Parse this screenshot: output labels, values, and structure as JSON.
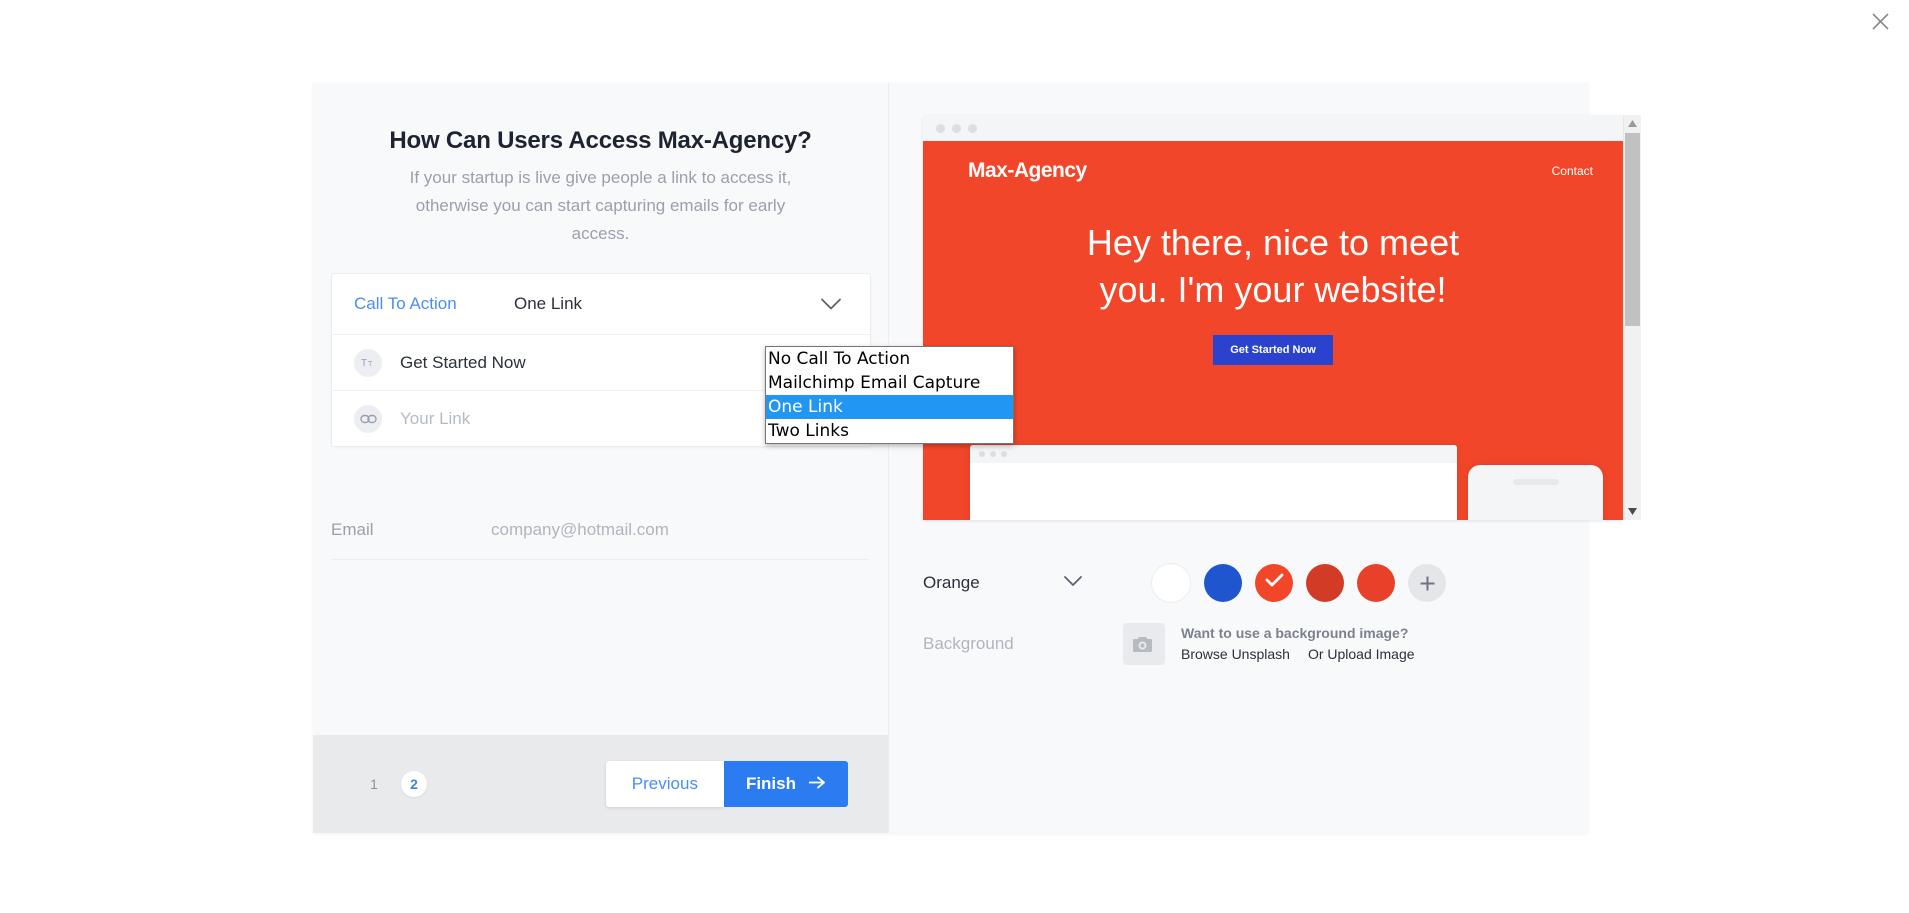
{
  "window": {
    "close_icon": "close-icon"
  },
  "left": {
    "headline": "How Can Users Access Max-Agency?",
    "subhead": "If your startup is live give people a link to access it, otherwise you can start capturing emails for early access.",
    "cta": {
      "label": "Call To Action",
      "selected_value": "One Link",
      "caret_icon": "chevron-down-icon",
      "options": [
        "No Call To Action",
        "Mailchimp Email Capture",
        "One Link",
        "Two Links"
      ],
      "selected_index": 2
    },
    "fields": [
      {
        "icon": "text-format-icon",
        "icon_glyph": "Tт",
        "value": "Get Started Now",
        "is_placeholder": false
      },
      {
        "icon": "link-icon",
        "icon_glyph": "link",
        "value": "Your Link",
        "is_placeholder": true
      }
    ],
    "email": {
      "label": "Email",
      "value": "company@hotmail.com"
    },
    "footer": {
      "steps": [
        "1",
        "2"
      ],
      "active_step": "2",
      "previous_label": "Previous",
      "finish_label": "Finish",
      "finish_arrow_icon": "arrow-right-icon"
    }
  },
  "right": {
    "preview": {
      "logo": "Max-Agency",
      "nav_link": "Contact",
      "hero_line1": "Hey there, nice to meet",
      "hero_line2": "you. I'm your website!",
      "hero_button": "Get Started Now",
      "hero_button_color": "#2b42cf",
      "background_color": "#f2462a"
    },
    "scrollbar": {
      "up_icon": "caret-up-icon",
      "down_icon": "caret-down-icon"
    },
    "color_picker": {
      "name": "Orange",
      "caret_icon": "chevron-down-icon",
      "add_icon": "plus-icon",
      "swatches": [
        {
          "name": "white",
          "color": "#ffffff",
          "selected": false
        },
        {
          "name": "blue",
          "color": "#1f56d0",
          "selected": false
        },
        {
          "name": "orange-red",
          "color": "#f2462a",
          "selected": true
        },
        {
          "name": "dark-red",
          "color": "#d23b26",
          "selected": false
        },
        {
          "name": "red-orange",
          "color": "#e8412a",
          "selected": false
        }
      ],
      "check_icon": "check-icon"
    },
    "background": {
      "label": "Background",
      "camera_icon": "camera-icon",
      "question": "Want to use a background image?",
      "links": [
        "Browse Unsplash",
        "Or Upload Image"
      ]
    }
  }
}
